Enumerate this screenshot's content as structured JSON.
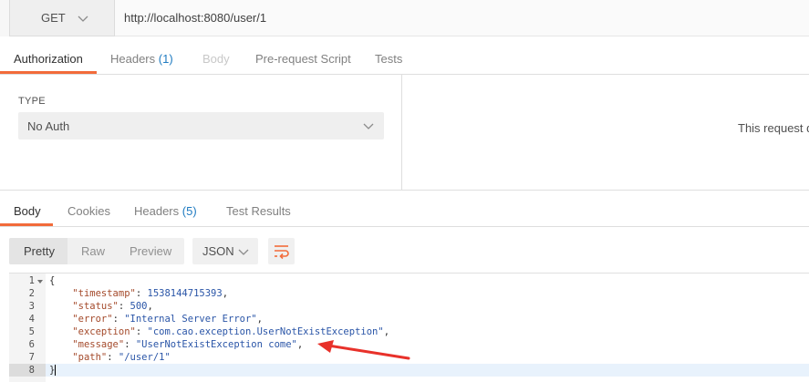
{
  "request": {
    "method": "GET",
    "url": "http://localhost:8080/user/1"
  },
  "request_tabs": [
    {
      "label": "Authorization",
      "state": "active"
    },
    {
      "label": "Headers",
      "count": "(1)",
      "state": "normal"
    },
    {
      "label": "Body",
      "state": "disabled"
    },
    {
      "label": "Pre-request Script",
      "state": "normal"
    },
    {
      "label": "Tests",
      "state": "normal"
    }
  ],
  "auth": {
    "type_label": "TYPE",
    "type_value": "No Auth",
    "right_text": "This request d"
  },
  "response_tabs": [
    {
      "label": "Body",
      "state": "active"
    },
    {
      "label": "Cookies",
      "state": "normal"
    },
    {
      "label": "Headers",
      "count": "(5)",
      "state": "normal"
    },
    {
      "label": "Test Results",
      "state": "normal"
    }
  ],
  "format": {
    "options": [
      "Pretty",
      "Raw",
      "Preview"
    ],
    "selected": "Pretty",
    "language": "JSON"
  },
  "code": {
    "line_numbers": [
      "1",
      "2",
      "3",
      "4",
      "5",
      "6",
      "7",
      "8"
    ],
    "open_brace": "{",
    "close_brace": "}",
    "entries": [
      {
        "key": "\"timestamp\"",
        "value": "1538144715393",
        "value_type": "number",
        "comma": true
      },
      {
        "key": "\"status\"",
        "value": "500",
        "value_type": "number",
        "comma": true
      },
      {
        "key": "\"error\"",
        "value": "\"Internal Server Error\"",
        "value_type": "string",
        "comma": true
      },
      {
        "key": "\"exception\"",
        "value": "\"com.cao.exception.UserNotExistException\"",
        "value_type": "string",
        "comma": true
      },
      {
        "key": "\"message\"",
        "value": "\"UserNotExistException come\"",
        "value_type": "string",
        "comma": true
      },
      {
        "key": "\"path\"",
        "value": "\"/user/1\"",
        "value_type": "string",
        "comma": false
      }
    ]
  },
  "colors": {
    "accent": "#f26b3a",
    "count_blue": "#1f7bc1",
    "json_key": "#a44a2b",
    "json_value": "#2a55a7",
    "arrow_red": "#e8312a"
  },
  "icons": {
    "method_dropdown": "chevron-down-icon",
    "type_dropdown": "chevron-down-icon",
    "language_dropdown": "chevron-down-icon",
    "wrap": "wrap-lines-icon",
    "fold": "fold-caret-icon",
    "annotation": "red-arrow-icon"
  }
}
